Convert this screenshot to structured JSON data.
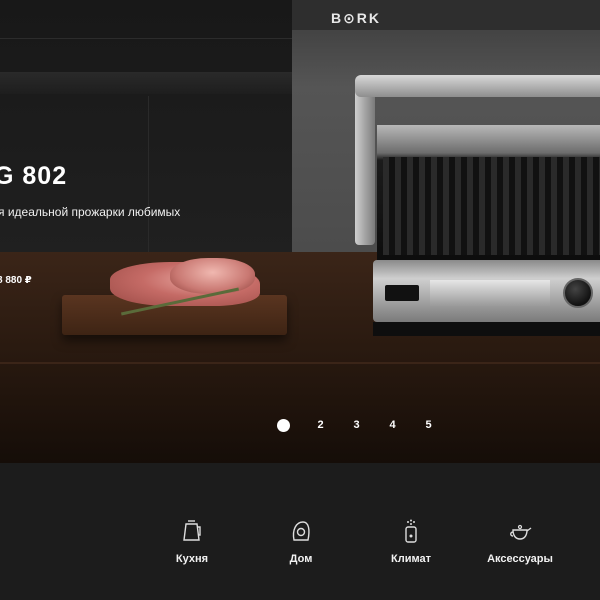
{
  "brand": {
    "logo": "B⊙RK"
  },
  "hero": {
    "model_title": "G 802",
    "subtitle": "я идеальной прожарки любимых",
    "price": "8 880 ₽"
  },
  "pager": {
    "items": [
      "2",
      "3",
      "4",
      "5"
    ],
    "active": 1
  },
  "categories": [
    {
      "label": "Кухня",
      "icon": "kettle-icon"
    },
    {
      "label": "Дом",
      "icon": "vacuum-icon"
    },
    {
      "label": "Климат",
      "icon": "humidifier-icon"
    },
    {
      "label": "Аксессуары",
      "icon": "teapot-icon"
    }
  ]
}
